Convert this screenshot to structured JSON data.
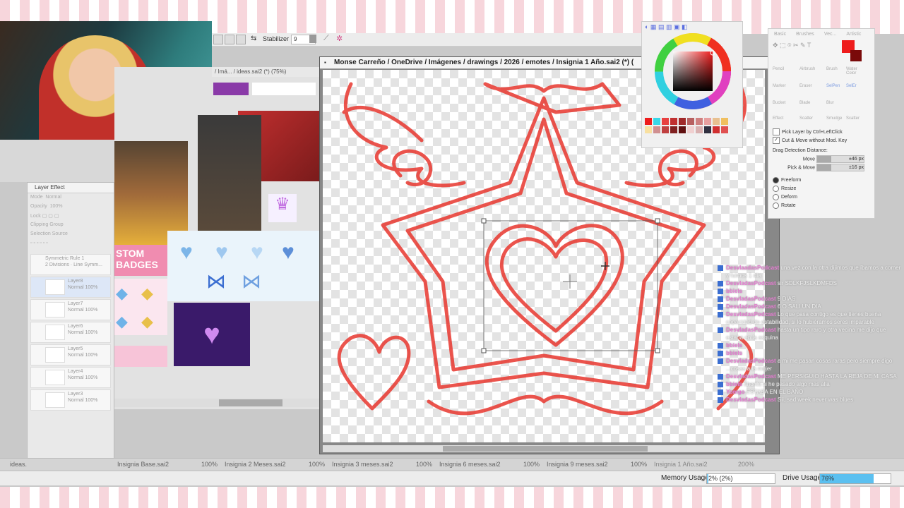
{
  "toolbar": {
    "stabilizer_label": "Stabilizer",
    "stabilizer_value": "9"
  },
  "reference_window": {
    "title": "/ Imá... / ideas.sai2 (*) (75%)"
  },
  "reference_images": {
    "badge_text_top": "STOM",
    "badge_text_bottom": "BADGES"
  },
  "canvas": {
    "title": "Monse Carreño / OneDrive / Imágenes / drawings / 2026 / emotes / Insignia 1 Año.sai2 (*) ("
  },
  "layer_panel": {
    "header": "Layer Effect",
    "mode_label": "Mode",
    "mode_value": "Normal",
    "opacity_label": "Opacity",
    "opacity_value": "100%",
    "lock_label": "Lock",
    "clipping_group": "Clipping Group",
    "selection_source": "Selection Source",
    "layers": [
      {
        "name": "Symmetric Rule 1",
        "sub": "2 Divisions · Line Symm..."
      },
      {
        "name": "Layer8",
        "sub": "Normal 100%"
      },
      {
        "name": "Layer7",
        "sub": "Normal 100%"
      },
      {
        "name": "Layer6",
        "sub": "Normal 100%"
      },
      {
        "name": "Layer5",
        "sub": "Normal 100%"
      },
      {
        "name": "Layer4",
        "sub": "Normal 100%"
      },
      {
        "name": "Layer3",
        "sub": "Normal 100%"
      }
    ]
  },
  "right_panel": {
    "tabs": [
      "Basic",
      "Brushes",
      "Vec...",
      "Artistic"
    ],
    "tool_names": [
      "Pencil",
      "Airbrush",
      "Brush",
      "Water Color",
      "Marker",
      "Eraser",
      "SelPen",
      "SelEr",
      "Bucket",
      "Blade",
      "Blur",
      "Effect",
      "Scatter",
      "Smudge",
      "Scatter"
    ],
    "pick_layer": "Pick Layer by Ctrl+LeftClick",
    "cut_move": "Cut & Move without Mod. Key",
    "drag_detection": "Drag Detection Distance:",
    "move_label": "Move",
    "move_value": "±46 px",
    "pick_move_label": "Pick & Move",
    "pick_move_value": "±16 px",
    "modes": [
      "Freeform",
      "Resize",
      "Deform",
      "Rotate"
    ],
    "selected_mode": "Freeform"
  },
  "chat": [
    {
      "user": "DesvlaadasPodcast",
      "text": "una vez con la otra dijimos que íbamos a comer"
    },
    {
      "user": "",
      "text": "y fuimos 1 día"
    },
    {
      "user": "DesvladasPodcast",
      "text": "sir SDLKFJSLKDMFDS"
    },
    {
      "user": "bbiels",
      "text": ""
    },
    {
      "user": "DesvladasPodcast",
      "text": "9 DIAS"
    },
    {
      "user": "DesvladasPodcast",
      "text": "6 O SALI UN DIA"
    },
    {
      "user": "DesvladasPodcast",
      "text": "Lo que pasa contigo es que tienes buena"
    },
    {
      "user": "",
      "text": "capacidad de estabilidad, si lo hubiéramos seres imparable"
    },
    {
      "user": "DesvladasPodcast",
      "text": "hasta un tipo raro y otra vecina me dijo que"
    },
    {
      "user": "",
      "text": "estaba en la esquina"
    },
    {
      "user": "bbiels",
      "text": ""
    },
    {
      "user": "bbiels",
      "text": ""
    },
    {
      "user": "DesvladasPodcast",
      "text": "a mi me pasan cosas raras pero siempre digo"
    },
    {
      "user": "",
      "text": "...cosas a la mujer"
    },
    {
      "user": "DesvladasPodcast",
      "text": "ME PERSIGUIO HASTA LA REJA DE MI CASA"
    },
    {
      "user": "bbiels",
      "text": "ahorita si he pasado algo mas alla"
    },
    {
      "user": "Yomgo",
      "text": "ESTABA EN EL BAÑO"
    },
    {
      "user": "DesvladasPodcast",
      "text": "Sii, sad week never was blues"
    }
  ],
  "file_tabs": [
    {
      "name": "ideas.",
      "pct": ""
    },
    {
      "name": "Insignia Base.sai2",
      "pct": "100%"
    },
    {
      "name": "Insignia 2 Meses.sai2",
      "pct": "100%"
    },
    {
      "name": "Insignia 3 meses.sai2",
      "pct": "100%"
    },
    {
      "name": "Insignia 6 meses.sai2",
      "pct": "100%"
    },
    {
      "name": "Insignia 9 meses.sai2",
      "pct": "100%"
    },
    {
      "name": "Insignia 1 Año.sai2",
      "pct": "200%"
    }
  ],
  "status": {
    "memory_label": "Memory Usage",
    "memory_value": "2% (2%)",
    "memory_fraction": 0.02,
    "drive_label": "Drive Usage",
    "drive_value": "76%",
    "drive_fraction": 0.76
  },
  "colors": {
    "primary": "#ee1c1c",
    "secondary": "#7a0a0a",
    "stroke": "#e8372f",
    "accent_chat_user": "#e47ad0",
    "drive_fill": "#5bc0f0"
  },
  "palette": [
    "#ee1c1c",
    "#38d8e8",
    "#e84040",
    "#c03030",
    "#a02828",
    "#b86060",
    "#d08080",
    "#e8a0a0",
    "#e8c090",
    "#f0c060",
    "#f8e0a0",
    "#d09090",
    "#c04040",
    "#802020",
    "#601010",
    "#f0d0d0",
    "#d8b0b0",
    "#303040",
    "#d03030",
    "#e05050"
  ]
}
